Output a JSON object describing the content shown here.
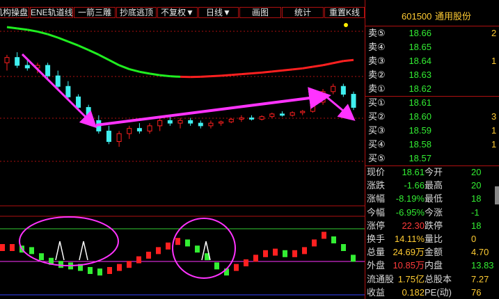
{
  "toolbar": {
    "buttons": [
      "机构操盘",
      "ENE轨道线",
      "一箭三雕",
      "抄底逃顶",
      "不复权▼",
      "日线▼",
      "画图",
      "统计",
      "重置K线"
    ]
  },
  "colors": {
    "up": "#ff2020",
    "down": "#40f0f0",
    "ma_up": "#ff2020",
    "ma_down": "#20ee20",
    "arrow": "#ff33ff",
    "grid": "#b01010",
    "annotation": "#ff33ff"
  },
  "stock": {
    "code": "601500",
    "name": "通用股份"
  },
  "order_book": {
    "sell": [
      {
        "label": "卖⑤",
        "price": "18.66",
        "vol": "2"
      },
      {
        "label": "卖④",
        "price": "18.65",
        "vol": ""
      },
      {
        "label": "卖③",
        "price": "18.64",
        "vol": "1"
      },
      {
        "label": "卖②",
        "price": "18.63",
        "vol": ""
      },
      {
        "label": "卖①",
        "price": "18.62",
        "vol": ""
      }
    ],
    "buy": [
      {
        "label": "买①",
        "price": "18.61",
        "vol": ""
      },
      {
        "label": "买②",
        "price": "18.60",
        "vol": "3"
      },
      {
        "label": "买③",
        "price": "18.59",
        "vol": "1"
      },
      {
        "label": "买④",
        "price": "18.58",
        "vol": "1"
      },
      {
        "label": "买⑤",
        "price": "18.57",
        "vol": ""
      }
    ]
  },
  "quote": [
    {
      "l1": "现价",
      "v1": "18.61",
      "c1": "green",
      "l2": "今开",
      "v2": "20",
      "c2": "green"
    },
    {
      "l1": "涨跌",
      "v1": "-1.66",
      "c1": "green",
      "l2": "最高",
      "v2": "20",
      "c2": "green"
    },
    {
      "l1": "涨幅",
      "v1": "-8.19%",
      "c1": "green",
      "l2": "最低",
      "v2": "18",
      "c2": "green"
    },
    {
      "l1": "今幅",
      "v1": "-6.95%",
      "c1": "green",
      "l2": "今涨",
      "v2": "-1",
      "c2": "green"
    },
    {
      "l1": "涨停",
      "v1": "22.30",
      "c1": "red",
      "l2": "跌停",
      "v2": "18",
      "c2": "green"
    },
    {
      "l1": "换手",
      "v1": "14.11%",
      "c1": "yellow",
      "l2": "量比",
      "v2": "0",
      "c2": "yellow"
    },
    {
      "l1": "总量",
      "v1": "24.69万",
      "c1": "yellow",
      "l2": "金额",
      "v2": "4.70",
      "c2": "yellow"
    },
    {
      "l1": "外盘",
      "v1": "10.85万",
      "c1": "red",
      "l2": "内盘",
      "v2": "13.83",
      "c2": "green"
    },
    {
      "l1": "流通股",
      "v1": "1.75亿",
      "c1": "yellow",
      "l2": "总股本",
      "v2": "7.27",
      "c2": "yellow"
    },
    {
      "l1": "收益",
      "v1": "0.182",
      "c1": "yellow",
      "l2": "PE(动)",
      "v2": "76",
      "c2": "yellow"
    }
  ],
  "chart_data": {
    "type": "candlestick",
    "title": "",
    "candles": [
      {
        "o": 20.2,
        "h": 20.5,
        "l": 19.9,
        "c": 20.4,
        "up": true
      },
      {
        "o": 20.4,
        "h": 20.6,
        "l": 20.0,
        "c": 20.1,
        "up": false
      },
      {
        "o": 20.1,
        "h": 20.3,
        "l": 19.9,
        "c": 20.0,
        "up": false
      },
      {
        "o": 20.0,
        "h": 20.2,
        "l": 19.8,
        "c": 20.1,
        "up": true
      },
      {
        "o": 20.1,
        "h": 20.2,
        "l": 19.6,
        "c": 19.7,
        "up": false
      },
      {
        "o": 19.7,
        "h": 19.9,
        "l": 19.2,
        "c": 19.3,
        "up": false
      },
      {
        "o": 19.3,
        "h": 19.5,
        "l": 18.8,
        "c": 18.9,
        "up": false
      },
      {
        "o": 18.9,
        "h": 19.0,
        "l": 18.4,
        "c": 18.5,
        "up": false
      },
      {
        "o": 18.5,
        "h": 18.6,
        "l": 17.9,
        "c": 18.0,
        "up": false
      },
      {
        "o": 18.0,
        "h": 18.2,
        "l": 17.5,
        "c": 17.6,
        "up": false
      },
      {
        "o": 17.6,
        "h": 17.8,
        "l": 17.1,
        "c": 17.2,
        "up": false
      },
      {
        "o": 17.2,
        "h": 17.6,
        "l": 17.0,
        "c": 17.5,
        "up": true
      },
      {
        "o": 17.5,
        "h": 17.8,
        "l": 17.3,
        "c": 17.7,
        "up": true
      },
      {
        "o": 17.7,
        "h": 17.9,
        "l": 17.5,
        "c": 17.6,
        "up": false
      },
      {
        "o": 17.6,
        "h": 17.9,
        "l": 17.5,
        "c": 17.8,
        "up": true
      },
      {
        "o": 17.8,
        "h": 18.1,
        "l": 17.6,
        "c": 18.0,
        "up": true
      },
      {
        "o": 18.0,
        "h": 18.2,
        "l": 17.8,
        "c": 17.9,
        "up": false
      },
      {
        "o": 17.9,
        "h": 18.1,
        "l": 17.7,
        "c": 18.0,
        "up": true
      },
      {
        "o": 18.0,
        "h": 18.1,
        "l": 17.8,
        "c": 17.9,
        "up": false
      },
      {
        "o": 17.9,
        "h": 18.0,
        "l": 17.7,
        "c": 17.8,
        "up": false
      },
      {
        "o": 17.8,
        "h": 18.0,
        "l": 17.7,
        "c": 17.9,
        "up": true
      },
      {
        "o": 17.9,
        "h": 18.0,
        "l": 17.8,
        "c": 17.95,
        "up": true
      },
      {
        "o": 17.95,
        "h": 18.1,
        "l": 17.9,
        "c": 18.05,
        "up": true
      },
      {
        "o": 18.05,
        "h": 18.2,
        "l": 17.95,
        "c": 18.1,
        "up": true
      },
      {
        "o": 18.1,
        "h": 18.2,
        "l": 18.0,
        "c": 18.05,
        "up": false
      },
      {
        "o": 18.05,
        "h": 18.2,
        "l": 18.0,
        "c": 18.15,
        "up": true
      },
      {
        "o": 18.15,
        "h": 18.3,
        "l": 18.1,
        "c": 18.25,
        "up": true
      },
      {
        "o": 18.25,
        "h": 18.35,
        "l": 18.15,
        "c": 18.2,
        "up": false
      },
      {
        "o": 18.2,
        "h": 18.35,
        "l": 18.15,
        "c": 18.3,
        "up": true
      },
      {
        "o": 18.3,
        "h": 18.4,
        "l": 18.2,
        "c": 18.35,
        "up": true
      },
      {
        "o": 18.35,
        "h": 18.8,
        "l": 18.3,
        "c": 18.7,
        "up": true
      },
      {
        "o": 18.7,
        "h": 19.2,
        "l": 18.6,
        "c": 19.1,
        "up": true
      },
      {
        "o": 19.1,
        "h": 19.4,
        "l": 19.0,
        "c": 19.3,
        "up": true
      },
      {
        "o": 19.3,
        "h": 19.4,
        "l": 18.9,
        "c": 19.0,
        "up": false
      },
      {
        "o": 19.0,
        "h": 19.1,
        "l": 18.4,
        "c": 18.5,
        "up": false
      }
    ],
    "ma": [
      20.55,
      20.5,
      20.45,
      20.38,
      20.28,
      20.15,
      20.0,
      19.85,
      19.68,
      19.5,
      19.3,
      19.1,
      18.95,
      18.85,
      18.78,
      18.72,
      18.68,
      18.66,
      18.65,
      18.66,
      18.68,
      18.7,
      18.73,
      18.76,
      18.79,
      18.82,
      18.86,
      18.9,
      18.94,
      18.98,
      19.04,
      19.1,
      19.18,
      19.26,
      19.3
    ],
    "ma_colors": [
      "g",
      "g",
      "g",
      "g",
      "g",
      "g",
      "g",
      "g",
      "g",
      "g",
      "g",
      "g",
      "g",
      "g",
      "g",
      "g",
      "g",
      "r",
      "r",
      "r",
      "r",
      "r",
      "r",
      "r",
      "r",
      "r",
      "r",
      "r",
      "r",
      "r",
      "r",
      "r",
      "r",
      "r",
      "g"
    ],
    "indicator": [
      1,
      1,
      0.9,
      0.8,
      0.4,
      0.1,
      -0.1,
      -0.2,
      -0.3,
      -0.5,
      -0.6,
      -0.5,
      -0.3,
      -0.1,
      0.2,
      0.5,
      0.8,
      1.1,
      1.4,
      1.3,
      0.9,
      0.4,
      -0.2,
      -0.6,
      -0.3,
      0,
      0.3,
      0.6,
      0.7,
      0.6,
      0.6,
      0.8,
      1.3,
      1.8,
      1.5,
      1.0,
      0.3
    ],
    "ylim": [
      16.5,
      21.0
    ]
  }
}
